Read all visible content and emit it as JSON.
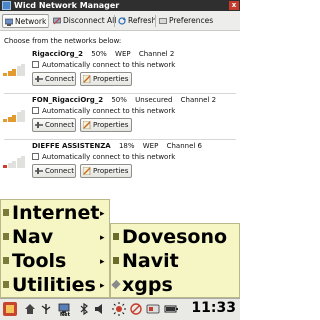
{
  "window": {
    "title": "Wicd Network Manager",
    "close_label": "x"
  },
  "toolbar": {
    "network": "Network",
    "disconnect_all": "Disconnect All",
    "refresh": "Refresh",
    "preferences": "Preferences"
  },
  "prompt": "Choose from the networks below:",
  "networks": [
    {
      "name": "RigacciOrg_2",
      "strength": "50%",
      "security": "WEP",
      "channel": "Channel 2",
      "signal_fraction": 0.5,
      "bar_color": "#e39a2e",
      "auto_label": "Automatically connect to this network",
      "connect": "Connect",
      "properties": "Properties"
    },
    {
      "name": "FON_RigacciOrg_2",
      "strength": "50%",
      "security": "Unsecured",
      "channel": "Channel 2",
      "signal_fraction": 0.5,
      "bar_color": "#e39a2e",
      "auto_label": "Automatically connect to this network",
      "connect": "Connect",
      "properties": "Properties"
    },
    {
      "name": "DIEFFE ASSISTENZA",
      "strength": "18%",
      "security": "WEP",
      "channel": "Channel 6",
      "signal_fraction": 0.18,
      "bar_color": "#d53a2a",
      "auto_label": "Automatically connect to this network",
      "connect": "Connect",
      "properties": "Properties"
    }
  ],
  "main_menu": [
    {
      "label": "Internet",
      "arrow": "▸"
    },
    {
      "label": "Nav",
      "arrow": "▸"
    },
    {
      "label": "Tools",
      "arrow": "▸"
    },
    {
      "label": "Utilities",
      "arrow": "▸"
    }
  ],
  "sub_menu": [
    {
      "label": "Dovesono"
    },
    {
      "label": "Navit"
    },
    {
      "label": "xgps"
    }
  ],
  "taskbar": {
    "net_label": "Net",
    "clock": "11:33"
  },
  "colors": {
    "menu_bg": "#f6f6c4",
    "signal_orange": "#e39a2e",
    "signal_red": "#d53a2a"
  }
}
